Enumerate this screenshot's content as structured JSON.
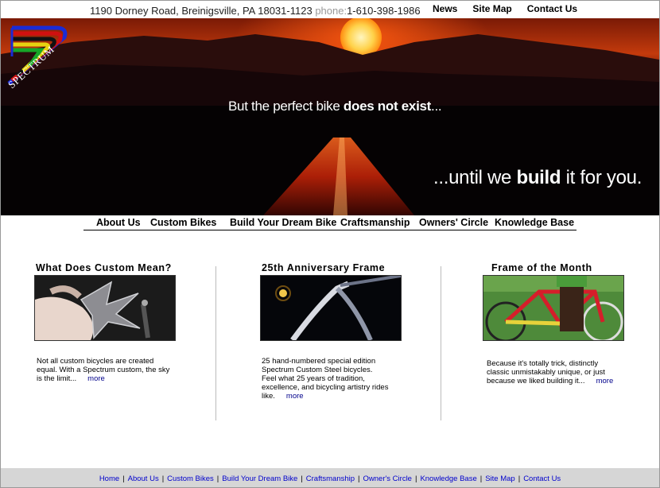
{
  "header": {
    "address": "1190 Dorney Road, Breinigsville, PA 18031-1123",
    "phone_label": "phone:",
    "phone": "1-610-398-1986",
    "links": [
      "News",
      "Site Map",
      "Contact Us"
    ]
  },
  "logo": {
    "text": "SPECTRUM"
  },
  "hero": {
    "line1_a": "But the perfect bike ",
    "line1_b": "does not exist",
    "line1_c": "...",
    "line2_a": "...until we ",
    "line2_b": "build",
    "line2_c": " it for you."
  },
  "nav": [
    "About Us",
    "Custom Bikes",
    "Build Your Dream Bike",
    "Craftsmanship",
    "Owners' Circle",
    "Knowledge Base"
  ],
  "features": [
    {
      "title": "What Does Custom Mean?",
      "text": "Not all custom bicycles are created equal. With a Spectrum custom, the sky is the limit...",
      "more": "more"
    },
    {
      "title": "25th Anniversary Frame",
      "text": "25 hand-numbered special edition Spectrum Custom Steel bicycles. Feel what 25 years of tradition, excellence, and bicycling artistry rides like.",
      "more": "more"
    },
    {
      "title": "Frame of the Month",
      "text": "Because it's totally trick, distinctly classic unmistakably unique, or just because we liked building it...",
      "more": "more"
    }
  ],
  "footer": [
    "Home",
    "About Us",
    "Custom Bikes",
    "Build Your Dream Bike",
    "Craftsmanship",
    "Owner's Circle",
    "Knowledge Base",
    "Site Map",
    "Contact Us"
  ]
}
